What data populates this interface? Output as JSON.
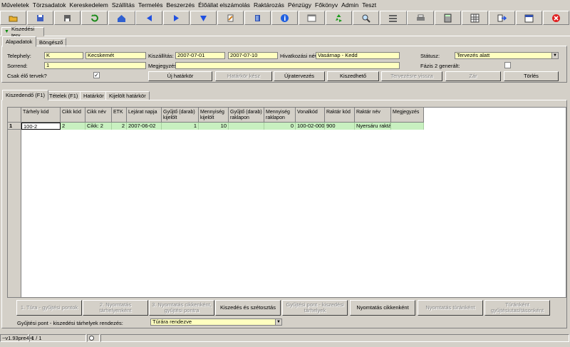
{
  "menu": [
    "Műveletek",
    "Törzsadatok",
    "Kereskedelem",
    "Szállítás",
    "Termelés",
    "Beszerzés",
    "Élőállat elszámolás",
    "Raktározás",
    "Pénzügy",
    "Főkönyv",
    "Admin",
    "Teszt"
  ],
  "toolbar_icons": [
    "folder-open-icon",
    "save-icon",
    "floppy-icon",
    "refresh-icon",
    "home-icon",
    "arrow-left-icon",
    "arrow-right-icon",
    "arrow-down-icon",
    "edit-icon",
    "book-icon",
    "info-icon",
    "window-icon",
    "recycle-icon",
    "magnifier-icon",
    "list-icon",
    "printer-icon",
    "calculator-icon",
    "grid-icon",
    "export-icon",
    "calendar-icon",
    "close-icon"
  ],
  "window_tab": "Kiszedési terv",
  "tabs_top": [
    "Alapadatok",
    "Böngésző"
  ],
  "form": {
    "telephely_label": "Telephely:",
    "telephely_code": "K",
    "telephely_name": "Kecskemét",
    "kiszallitas_label": "Kiszállítás:",
    "kiszallitas_from": "2007-07-01",
    "kiszallitas_to": "2007-07-10",
    "hivatkozasi_label": "Hivatkozási név:",
    "hivatkozasi_value": "Vasárnap - Kedd",
    "statusz_label": "Státusz:",
    "statusz_value": "Tervezés alatt",
    "sorrend_label": "Sorrend:",
    "sorrend_value": "1",
    "megjegyzes_label": "Megjegyzés:",
    "megjegyzes_value": "",
    "fazis_label": "Fázis 2 generált:",
    "csak_elo_label": "Csak élő tervek?",
    "csak_elo_check": "✓"
  },
  "top_buttons": [
    {
      "label": "Új határkör",
      "disabled": false
    },
    {
      "label": "Határkör kész",
      "disabled": true
    },
    {
      "label": "Újratervezés",
      "disabled": false
    },
    {
      "label": "Kiszedhető",
      "disabled": false
    },
    {
      "label": "Tervezésre vissza",
      "disabled": true
    },
    {
      "label": "Zár",
      "disabled": true
    },
    {
      "label": "Törlés",
      "disabled": false
    }
  ],
  "tabs_bottom": [
    "Kiszedendő (F1)",
    "Tételek (F1)",
    "Határkör",
    "Kijelölt határkör"
  ],
  "grid": {
    "columns": [
      "Tárhely kód",
      "Cikk kód",
      "Cikk név",
      "ETK",
      "Lejárat napja",
      "Gyűjtő (darab) kijelölt",
      "Mennyiség kijelölt",
      "Gyűjtő (darab) raklapon",
      "Mennyiség raklapon",
      "Vonalkód",
      "Raktár kód",
      "Raktár név",
      "Megjegyzés"
    ],
    "row_index": "1",
    "row": [
      "100-2",
      "2",
      "Cikk: 2",
      "2",
      "2007-06-02",
      "1",
      "10",
      "",
      "0",
      "100-02-000",
      "900",
      "Nyersáru raktár",
      ""
    ]
  },
  "bottom_buttons": [
    {
      "label": "1. Túra - gyűjtési pontok",
      "disabled": true
    },
    {
      "label": "2. Nyomtatás tárhelyenként",
      "disabled": true
    },
    {
      "label": "3. Nyomtatás cikkenként, gyűjtési pontra",
      "disabled": true
    },
    {
      "label": "Kiszedés és szétosztás",
      "disabled": false
    },
    {
      "label": "Gyűjtési pont - kiszedési tárhelyek",
      "disabled": true
    },
    {
      "label": "Nyomtatás cikkenként",
      "disabled": false
    },
    {
      "label": "Nyomtatás túránként",
      "disabled": true
    },
    {
      "label": "Túránként gyűjtésiutasításonként",
      "disabled": true
    }
  ],
  "sort_label": "Gyűjtési pont - kiszedési tárhelyek rendezés:",
  "sort_value": "Túrára rendezve",
  "status": {
    "version": "~v1.93pre4H",
    "page": "1 / 1"
  },
  "colors": {
    "yellow_field": "#ffffc0",
    "grid_row": "#c8f0c0",
    "chrome": "#d4d0c8"
  }
}
